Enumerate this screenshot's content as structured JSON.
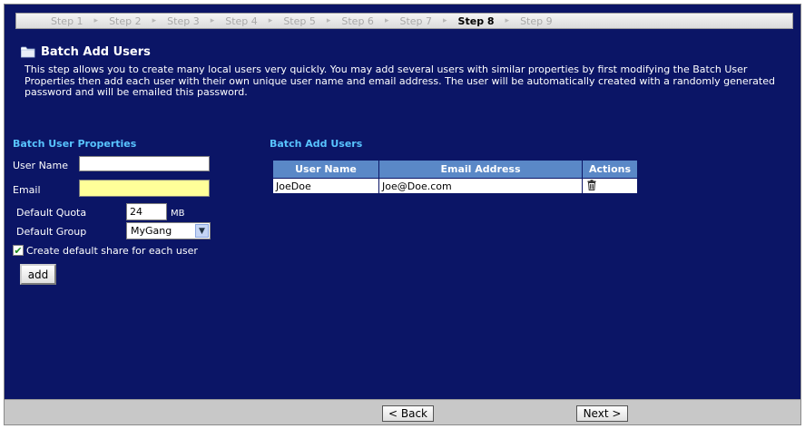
{
  "steps": [
    {
      "label": "Step 1",
      "active": false
    },
    {
      "label": "Step 2",
      "active": false
    },
    {
      "label": "Step 3",
      "active": false
    },
    {
      "label": "Step 4",
      "active": false
    },
    {
      "label": "Step 5",
      "active": false
    },
    {
      "label": "Step 6",
      "active": false
    },
    {
      "label": "Step 7",
      "active": false
    },
    {
      "label": "Step 8",
      "active": true
    },
    {
      "label": "Step 9",
      "active": false
    }
  ],
  "page": {
    "title": "Batch Add Users",
    "description": "This step allows you to create many local users very quickly. You may add several users with similar properties by first modifying the Batch User Properties then add each user with their own unique user name and email address. The user will be automatically created with a randomly generated password and will be emailed this password."
  },
  "properties": {
    "heading": "Batch User Properties",
    "username_label": "User Name",
    "username_value": "",
    "email_label": "Email",
    "email_value": "",
    "quota_label": "Default Quota",
    "quota_value": "24",
    "quota_unit": "MB",
    "group_label": "Default Group",
    "group_value": "MyGang",
    "share_label": "Create default share for each user",
    "share_checked": true,
    "add_label": "add"
  },
  "batch": {
    "heading": "Batch Add Users",
    "columns": [
      "User Name",
      "Email Address",
      "Actions"
    ],
    "rows": [
      {
        "username": "JoeDoe",
        "email": "Joe@Doe.com",
        "action_icon": "trash-icon"
      }
    ]
  },
  "footer": {
    "back_label": "< Back",
    "next_label": "Next >"
  },
  "colors": {
    "background": "#0b1566",
    "section_heading": "#58c4ff",
    "table_header": "#5a88c7",
    "email_field": "#ffff99"
  }
}
